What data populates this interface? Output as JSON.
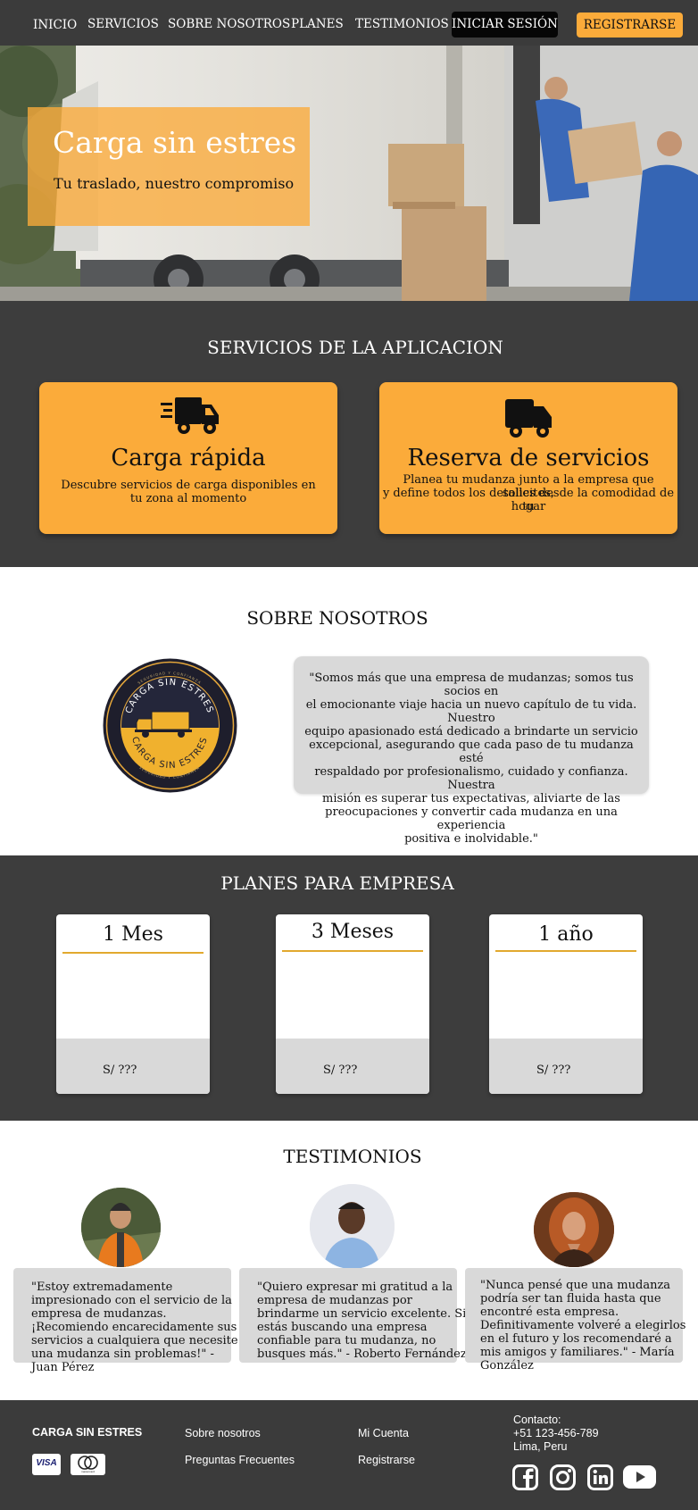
{
  "nav": {
    "links": [
      "INICIO",
      "SERVICIOS",
      "SOBRE NOSOTROS",
      "PLANES",
      "TESTIMONIOS"
    ],
    "login": "INICIAR SESIÓN",
    "register": "REGISTRARSE"
  },
  "hero": {
    "title": "Carga sin estres",
    "subtitle": "Tu traslado, nuestro compromiso"
  },
  "services": {
    "title": "SERVICIOS DE LA APLICACION",
    "cards": [
      {
        "icon": "fast-truck-icon",
        "title": "Carga rápida",
        "desc": [
          "Descubre servicios de carga disponibles en",
          "tu zona al momento"
        ]
      },
      {
        "icon": "truck-icon",
        "title": "Reserva de servicios",
        "desc": [
          "Planea tu mudanza junto a la empresa que solicites,",
          "y define todos los detalles  desde la comodidad de tu",
          "hogar"
        ]
      }
    ]
  },
  "about": {
    "title": "SOBRE NOSOTROS",
    "logo_top": "CARGA SIN ESTRES",
    "logo_bottom": "CARGA SIN ESTRES",
    "logo_ring_top": "SEGURIDAD Y CONFIANZA",
    "logo_ring_bottom": "SEGURIDAD Y CONFIANZA",
    "text": [
      "\"Somos más que una empresa de mudanzas; somos tus socios en",
      "el emocionante viaje hacia un nuevo capítulo de tu vida. Nuestro",
      "equipo apasionado está dedicado a brindarte un servicio",
      "excepcional, asegurando que cada paso de tu mudanza esté",
      "respaldado por profesionalismo, cuidado y confianza. Nuestra",
      "misión es superar tus expectativas, aliviarte de las",
      "preocupaciones y convertir cada mudanza en una experiencia",
      "positiva e inolvidable.\""
    ]
  },
  "plans": {
    "title": "PLANES PARA EMPRESA",
    "items": [
      {
        "name": "1 Mes",
        "price": "S/ ???"
      },
      {
        "name": "3 Meses",
        "price": "S/ ???"
      },
      {
        "name": "1 año",
        "price": "S/ ???"
      }
    ]
  },
  "testimonials": {
    "title": "TESTIMONIOS",
    "items": [
      {
        "lines": [
          "\"Estoy extremadamente",
          "impresionado con el servicio de la",
          "empresa de mudanzas.",
          "¡Recomiendo encarecidamente sus",
          "servicios a cualquiera que necesite",
          "una mudanza sin problemas!\" -",
          "Juan Pérez"
        ]
      },
      {
        "lines": [
          "\"Quiero expresar mi gratitud a la",
          "empresa de mudanzas por",
          "brindarme un servicio excelente. Si",
          "estás buscando una empresa",
          "confiable para tu mudanza, no",
          "busques más.\" - Roberto Fernández"
        ]
      },
      {
        "lines": [
          "\"Nunca pensé que una mudanza",
          "podría ser tan fluida hasta que",
          "encontré esta empresa.",
          "Definitivamente volveré a elegirlos",
          "en el futuro y los recomendaré a",
          "mis amigos y familiares.\" - María",
          "González"
        ]
      }
    ]
  },
  "footer": {
    "brand": "CARGA SIN ESTRES",
    "links_col1": [
      "Sobre nosotros",
      "Preguntas Frecuentes"
    ],
    "links_col2": [
      "Mi Cuenta",
      "Registrarse"
    ],
    "contact": [
      "Contacto:",
      "+51 123-456-789",
      "Lima, Peru"
    ],
    "payment": [
      "VISA",
      "mastercard"
    ],
    "social": [
      "facebook-icon",
      "instagram-icon",
      "linkedin-icon",
      "youtube-icon"
    ]
  },
  "colors": {
    "accent": "#fbab3a",
    "dark": "#3d3d3d",
    "card_gray": "#d9d9d9"
  }
}
